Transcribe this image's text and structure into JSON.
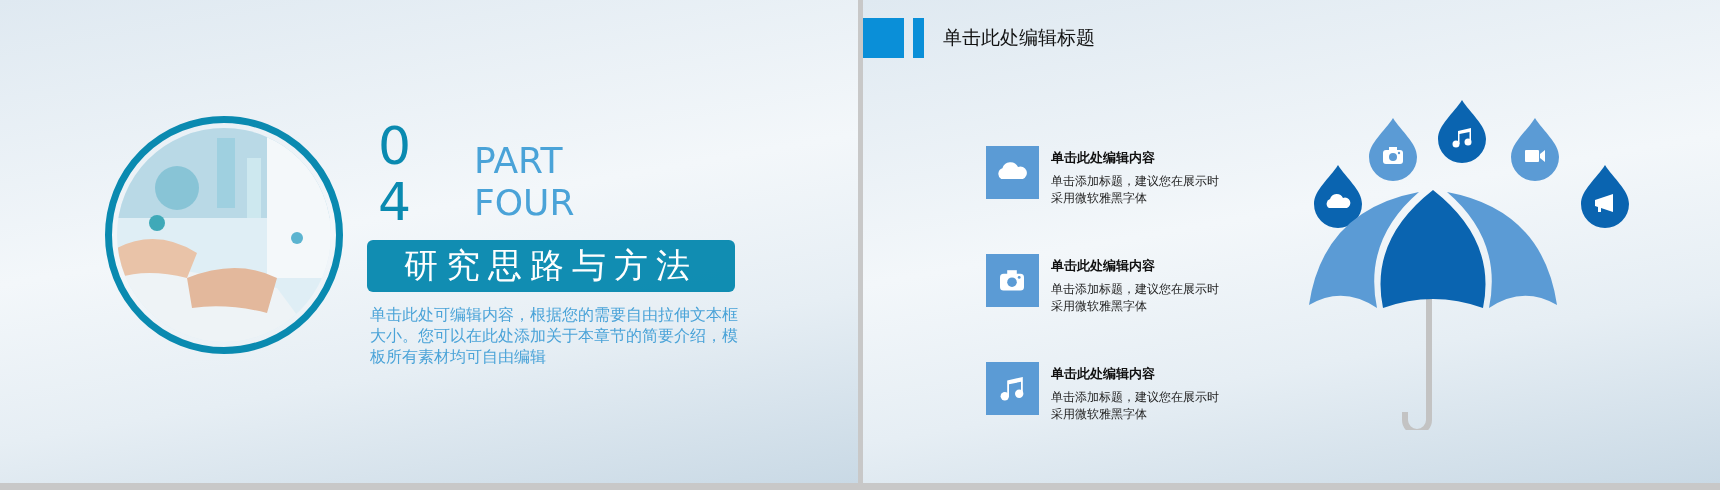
{
  "slides": [
    {
      "kind": "section",
      "number": "0\n4",
      "part": "PART\nFOUR",
      "title": "研究思路与方法",
      "body": "单击此处可编辑内容，根据您的需要自由拉伸文本框大小。您可以在此处添加关于本章节的简要介绍，模板所有素材均可自由编辑"
    },
    {
      "kind": "list",
      "title": "单击此处编辑标题",
      "items": [
        {
          "kind": "cloud",
          "heading": "单击此处编辑内容",
          "text": "单击添加标题，建议您在展示时采用微软雅黑字体"
        },
        {
          "kind": "camera",
          "heading": "单击此处编辑内容",
          "text": "单击添加标题，建议您在展示时采用微软雅黑字体"
        },
        {
          "kind": "music",
          "heading": "单击此处编辑内容",
          "text": "单击添加标题，建议您在展示时采用微软雅黑字体"
        }
      ],
      "drops": [
        {
          "kind": "cloud",
          "color": "#0a64b0"
        },
        {
          "kind": "camera",
          "color": "#5b9bd5"
        },
        {
          "kind": "music",
          "color": "#0a64b0"
        },
        {
          "kind": "video",
          "color": "#5b9bd5"
        },
        {
          "kind": "megaphone",
          "color": "#0a64b0"
        }
      ]
    }
  ]
}
